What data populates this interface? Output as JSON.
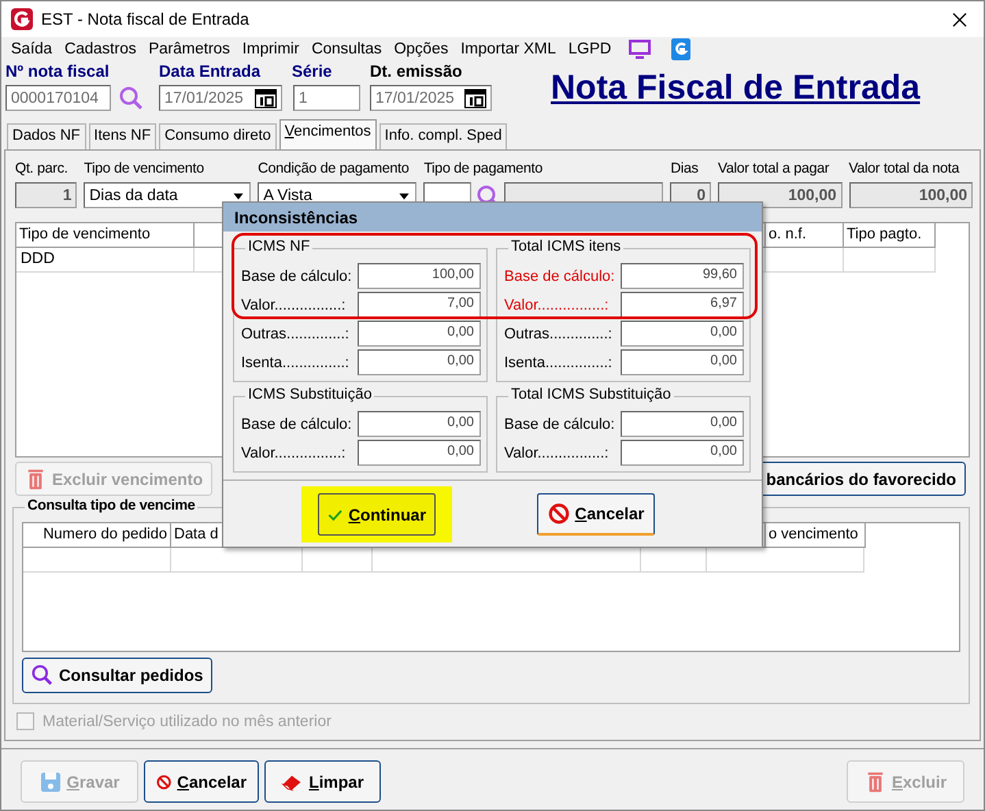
{
  "window": {
    "title": "EST - Nota fiscal de Entrada"
  },
  "menu": [
    "Saída",
    "Cadastros",
    "Parâmetros",
    "Imprimir",
    "Consultas",
    "Opções",
    "Importar XML",
    "LGPD"
  ],
  "header": {
    "fields": [
      {
        "label": "Nº nota fiscal",
        "value": "0000170104",
        "kind": "search",
        "required": true
      },
      {
        "label": "Data Entrada",
        "value": "17/01/2025",
        "kind": "date",
        "required": true
      },
      {
        "label": "Série",
        "value": "1",
        "kind": "text",
        "required": true
      },
      {
        "label": "Dt. emissão",
        "value": "17/01/2025",
        "kind": "date",
        "required": false
      }
    ],
    "title": "Nota Fiscal de Entrada"
  },
  "tabs": [
    {
      "label": "Dados NF",
      "selected": false
    },
    {
      "label": "Itens NF",
      "selected": false
    },
    {
      "label": "Consumo direto",
      "selected": false
    },
    {
      "label": "Vencimentos",
      "selected": true
    },
    {
      "label": "Info. compl. Sped",
      "selected": false
    }
  ],
  "payment": [
    {
      "label": "Qt. parc.",
      "value": "1",
      "kind": "number"
    },
    {
      "label": "Tipo de vencimento",
      "value": "Dias da data",
      "kind": "dropdown"
    },
    {
      "label": "Condição de pagamento",
      "value": "A Vista",
      "kind": "dropdown"
    },
    {
      "label": "Tipo de pagamento",
      "kind": "lookup"
    },
    {
      "label": "Dias",
      "value": "0",
      "kind": "number"
    },
    {
      "label": "Valor total a pagar",
      "value": "100,00",
      "kind": "number"
    },
    {
      "label": "Valor total da nota",
      "value": "100,00",
      "kind": "number"
    }
  ],
  "installments_table": {
    "columns": [
      "Tipo de vencimento",
      "o. n.f.",
      "Tipo pagto."
    ],
    "rows": [
      [
        "DDD"
      ]
    ]
  },
  "delete_installment_button": {
    "label": "Excluir vencimento",
    "disabled": true
  },
  "bank_button": {
    "label": "bancários do favorecido"
  },
  "orders_group": {
    "title": "Consulta tipo de vencime",
    "columns": [
      "Numero do pedido",
      "Data d",
      "o vencimento"
    ],
    "button": "Consultar pedidos"
  },
  "previous_month_checkbox": {
    "label": "Material/Serviço utilizado no mês anterior",
    "checked": false,
    "disabled": true
  },
  "footer_buttons": [
    {
      "label": "Gravar",
      "kind": "save",
      "disabled": true
    },
    {
      "label": "Cancelar",
      "kind": "cancel",
      "disabled": false
    },
    {
      "label": "Limpar",
      "kind": "clear",
      "disabled": false
    },
    {
      "label": "Excluir",
      "kind": "delete",
      "disabled": true
    }
  ],
  "dialog": {
    "title": "Inconsistências",
    "groups": [
      {
        "title": "ICMS NF",
        "rows": [
          {
            "label": "Base de cálculo:",
            "value": "100,00",
            "warning": false
          },
          {
            "label": "Valor................:",
            "value": "7,00",
            "warning": false
          },
          {
            "label": "Outras..............:",
            "value": "0,00",
            "warning": false
          },
          {
            "label": "Isenta...............:",
            "value": "0,00",
            "warning": false
          }
        ]
      },
      {
        "title": "Total ICMS itens",
        "rows": [
          {
            "label": "Base de cálculo:",
            "value": "99,60",
            "warning": true
          },
          {
            "label": "Valor................:",
            "value": "6,97",
            "warning": true
          },
          {
            "label": "Outras..............:",
            "value": "0,00",
            "warning": false
          },
          {
            "label": "Isenta...............:",
            "value": "0,00",
            "warning": false
          }
        ]
      },
      {
        "title": "ICMS Substituição",
        "rows": [
          {
            "label": "Base de cálculo:",
            "value": "0,00",
            "warning": false
          },
          {
            "label": "Valor................:",
            "value": "0,00",
            "warning": false
          }
        ]
      },
      {
        "title": "Total ICMS Substituição",
        "rows": [
          {
            "label": "Base de cálculo:",
            "value": "0,00",
            "warning": false
          },
          {
            "label": "Valor................:",
            "value": "0,00",
            "warning": false
          }
        ]
      }
    ],
    "buttons": [
      {
        "label": "Continuar",
        "kind": "ok",
        "highlighted": true
      },
      {
        "label": "Cancelar",
        "kind": "cancel",
        "highlighted": false
      }
    ]
  }
}
